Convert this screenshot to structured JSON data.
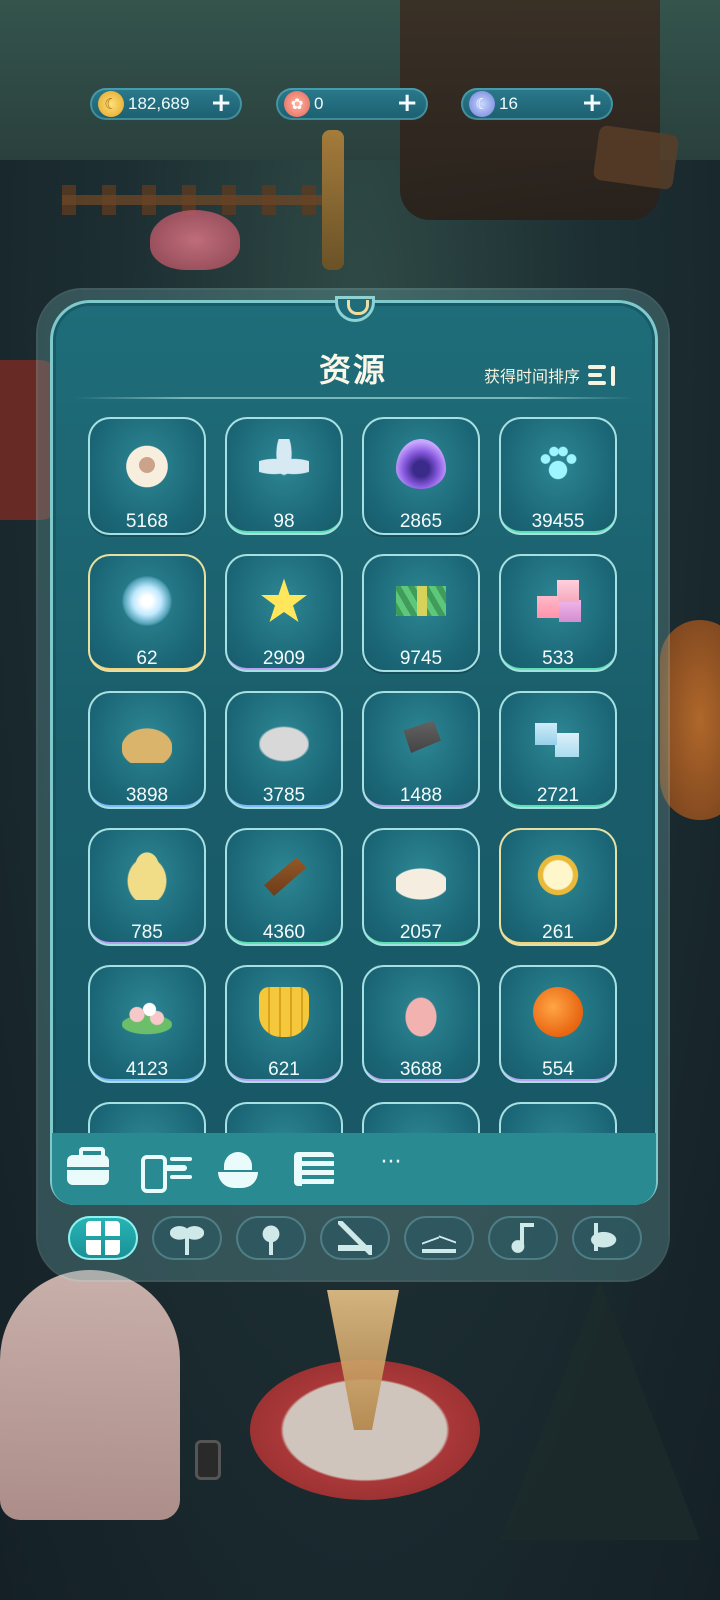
{
  "currencies": [
    {
      "name": "coin",
      "value": "182,689",
      "icon": "coin-icon",
      "plus": "+"
    },
    {
      "name": "flower",
      "value": "0",
      "icon": "flower-badge-icon",
      "plus": "+"
    },
    {
      "name": "moon",
      "value": "16",
      "icon": "moon-icon",
      "plus": "+"
    }
  ],
  "panel": {
    "title": "资源",
    "sort_label": "获得时间排序",
    "sort_icon": "sort-descending-icon"
  },
  "items": [
    {
      "name": "wool",
      "icon": "sheep-wool-icon",
      "qty": "5168"
    },
    {
      "name": "crystal-flower",
      "icon": "crystal-flower-icon",
      "qty": "98"
    },
    {
      "name": "purple-flame",
      "icon": "purple-flame-icon",
      "qty": "2865"
    },
    {
      "name": "paw-print",
      "icon": "paw-print-icon",
      "qty": "39455"
    },
    {
      "name": "spirit-orb",
      "icon": "spirit-orb-icon",
      "qty": "62"
    },
    {
      "name": "star",
      "icon": "star-icon",
      "qty": "2909"
    },
    {
      "name": "grass-bundle",
      "icon": "grass-bundle-icon",
      "qty": "9745"
    },
    {
      "name": "sugar-cubes",
      "icon": "sugar-cubes-icon",
      "qty": "533"
    },
    {
      "name": "sand",
      "icon": "sand-pile-icon",
      "qty": "3898"
    },
    {
      "name": "stone",
      "icon": "stone-icon",
      "qty": "3785"
    },
    {
      "name": "iron-pipe",
      "icon": "iron-pipe-icon",
      "qty": "1488"
    },
    {
      "name": "ice-cubes",
      "icon": "ice-cubes-icon",
      "qty": "2721"
    },
    {
      "name": "pear",
      "icon": "pear-icon",
      "qty": "785"
    },
    {
      "name": "wood-log",
      "icon": "wood-log-icon",
      "qty": "4360"
    },
    {
      "name": "flour",
      "icon": "flour-pile-icon",
      "qty": "2057"
    },
    {
      "name": "pocket-watch",
      "icon": "pocket-watch-icon",
      "qty": "261"
    },
    {
      "name": "dango",
      "icon": "dango-icon",
      "qty": "4123"
    },
    {
      "name": "banana",
      "icon": "banana-bunch-icon",
      "qty": "621"
    },
    {
      "name": "cream",
      "icon": "cream-swirl-icon",
      "qty": "3688"
    },
    {
      "name": "orange",
      "icon": "orange-icon",
      "qty": "554"
    }
  ],
  "toolbar": {
    "more_label": "···",
    "buttons": [
      "briefcase-icon",
      "shop-icon",
      "food-bowl-icon",
      "book-icon",
      "more-icon"
    ]
  },
  "tabs": [
    "grid-icon",
    "sprout-icon",
    "lamp-icon",
    "build-icon",
    "hanger-icon",
    "music-icon",
    "fishing-icon"
  ],
  "colors": {
    "panel": "#1a5d6a",
    "panel_border": "#7fc8cc",
    "tile": "#1b6777",
    "active_tab": "#27b6b6",
    "title_text": "#fbf6e8"
  }
}
